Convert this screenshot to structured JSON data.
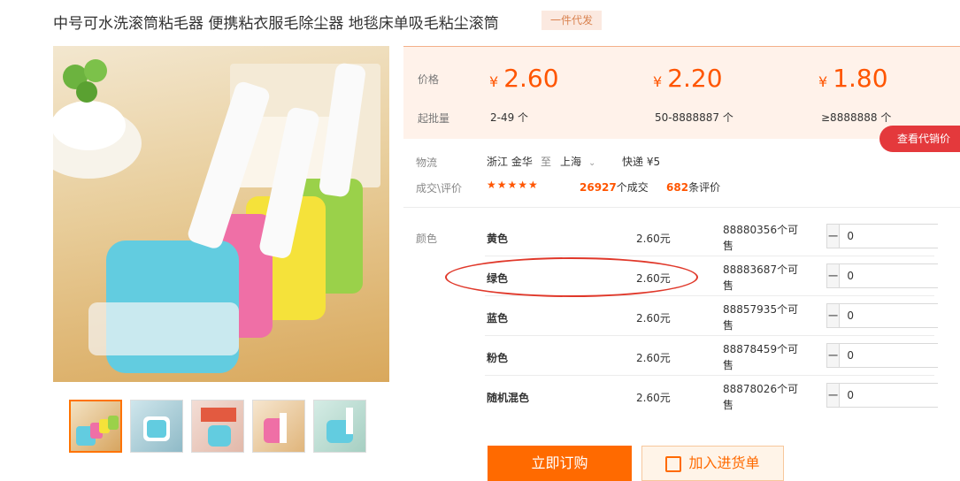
{
  "product": {
    "title": "中号可水洗滚筒粘毛器 便携粘衣服毛除尘器 地毯床单吸毛粘尘滚筒",
    "badge": "一件代发"
  },
  "price_tiers": {
    "price_label": "价格",
    "qty_label": "起批量",
    "currency": "¥",
    "tiers": [
      {
        "price": "2.60",
        "range": "2-49 个"
      },
      {
        "price": "2.20",
        "range": "50-8888887 个"
      },
      {
        "price": "1.80",
        "range": "≥8888888 个"
      }
    ]
  },
  "agent_button": "查看代销价",
  "shipping": {
    "label": "物流",
    "from": "浙江 金华",
    "to_word": "至",
    "to": "上海",
    "method": "快递 ¥5"
  },
  "stats": {
    "label": "成交\\评价",
    "stars": "★★★★★",
    "deals_count": "26927",
    "deals_unit": "个成交",
    "reviews_count": "682",
    "reviews_unit": "条评价"
  },
  "variants": {
    "label": "颜色",
    "items": [
      {
        "name": "黄色",
        "price": "2.60元",
        "stock": "88880356个可售",
        "qty": "0"
      },
      {
        "name": "绿色",
        "price": "2.60元",
        "stock": "88883687个可售",
        "qty": "0"
      },
      {
        "name": "蓝色",
        "price": "2.60元",
        "stock": "88857935个可售",
        "qty": "0"
      },
      {
        "name": "粉色",
        "price": "2.60元",
        "stock": "88878459个可售",
        "qty": "0"
      },
      {
        "name": "随机混色",
        "price": "2.60元",
        "stock": "88878026个可售",
        "qty": "0"
      }
    ]
  },
  "actions": {
    "buy": "立即订购",
    "cart": "加入进货单"
  },
  "colors": {
    "accent": "#ff5500",
    "buy_button": "#ff6a00",
    "agent_button": "#e4393c",
    "annotation_oval": "#e0382a"
  }
}
